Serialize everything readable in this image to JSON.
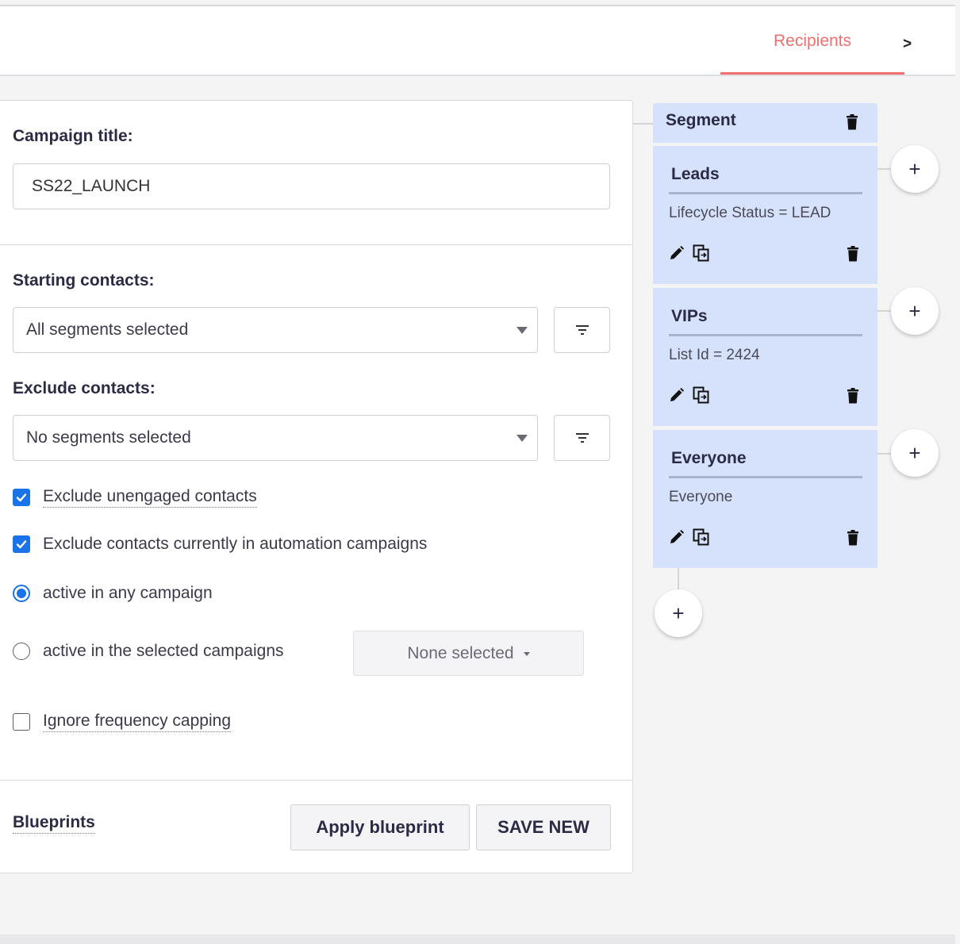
{
  "tabs": {
    "active_label": "Recipients",
    "next_label": ">"
  },
  "form": {
    "campaign_title_label": "Campaign title:",
    "campaign_title_value": "SS22_LAUNCH",
    "starting_contacts_label": "Starting contacts:",
    "starting_contacts_value": "All segments selected",
    "exclude_contacts_label": "Exclude contacts:",
    "exclude_contacts_value": "No segments selected",
    "exclude_unengaged": {
      "label": "Exclude unengaged contacts",
      "checked": true
    },
    "exclude_automation": {
      "label": "Exclude contacts currently in automation campaigns",
      "checked": true
    },
    "radio_any": {
      "label": "active in any campaign",
      "selected": true
    },
    "radio_selected": {
      "label": "active in the selected campaigns",
      "selected": false
    },
    "campaigns_select_value": "None selected",
    "ignore_frequency": {
      "label": "Ignore frequency capping",
      "checked": false
    },
    "blueprints_label": "Blueprints",
    "apply_blueprint_label": "Apply blueprint",
    "save_new_label": "SAVE NEW"
  },
  "segment_panel": {
    "title": "Segment",
    "cards": [
      {
        "name": "Leads",
        "condition": "Lifecycle Status = LEAD"
      },
      {
        "name": "VIPs",
        "condition": "List Id = 2424"
      },
      {
        "name": "Everyone",
        "condition": "Everyone"
      }
    ],
    "add_symbol": "+"
  },
  "colors": {
    "accent": "#ef6f6f",
    "checkbox": "#1a73e8",
    "segment_bg": "#d6e2fb"
  }
}
